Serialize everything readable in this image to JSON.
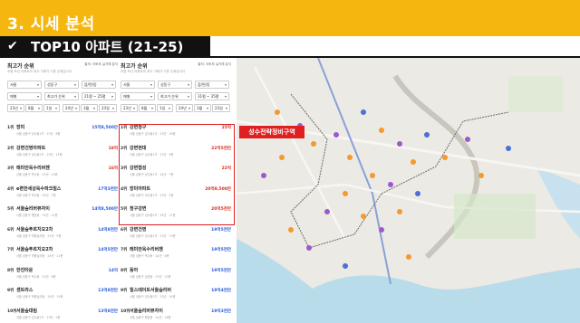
{
  "header": {
    "section_title": "3. 시세 분석",
    "subtitle": "TOP10 아파트 (21-25)",
    "check_icon": "check-icon"
  },
  "colors": {
    "accent": "#f5b70f",
    "highlight": "#e02020",
    "price_blue": "#2a5bd7"
  },
  "left_panel": {
    "title": "최고가 순위",
    "note": "출처: 국토부 실거래 분석",
    "desc": "지정 조건 아파트의 최고 거래가 기준 순위입니다",
    "filters": {
      "region": "서울",
      "district": "성동구",
      "dong": "읍/면/동",
      "type": "매매",
      "sort": "최고가 순위",
      "size": "21평 ~ 25평",
      "from_year": "23년",
      "from_month": "8월",
      "from_day": "1일",
      "to_year": "24년",
      "to_month": "3월",
      "to_day": "23일"
    },
    "ranks": [
      {
        "rank": "1위",
        "name": "장미",
        "sub": "서울 성동구 성수동1가 · 23년 · 8층",
        "price": "15억8,500만"
      },
      {
        "rank": "2위",
        "name": "강변건영아파트",
        "sub": "서울 성동구 성수동2가 · 23년 · 14층",
        "price": "18억"
      },
      {
        "rank": "3위",
        "name": "래미안옥수리버젠",
        "sub": "서울 성동구 옥수동 · 23년 · 10층",
        "price": "16억"
      },
      {
        "rank": "4위",
        "name": "e편한세상옥수파크힐스",
        "sub": "서울 성동구 옥수동 · 24년 · 7층",
        "price": "17억3천만"
      },
      {
        "rank": "5위",
        "name": "서울숲리버뷰자이",
        "sub": "서울 성동구 행당동 · 23년 · 12층",
        "price": "14억8,500만"
      },
      {
        "rank": "6위",
        "name": "서울숲푸르지오2차",
        "sub": "서울 성동구 하왕십리동 · 23년 · 9층",
        "price": "14억8천만"
      },
      {
        "rank": "7위",
        "name": "서울숲푸르지오2차",
        "sub": "서울 성동구 하왕십리동 · 24년 · 11층",
        "price": "14억5천만"
      },
      {
        "rank": "8위",
        "name": "한진타운",
        "sub": "서울 성동구 옥수동 · 23년 · 6층",
        "price": "14억"
      },
      {
        "rank": "9위",
        "name": "센트라스",
        "sub": "서울 성동구 하왕십리동 · 24년 · 15층",
        "price": "13억8천만"
      },
      {
        "rank": "10위",
        "name": "서울숲대림",
        "sub": "서울 성동구 성수동2가 · 23년 · 5층",
        "price": "13억8천만"
      }
    ]
  },
  "mid_panel": {
    "title": "최고가 순위",
    "note": "출처: 국토부 실거래 분석",
    "desc": "지정 조건 아파트의 최고 거래가 기준 순위입니다",
    "filters": {
      "region": "서울",
      "district": "성동구",
      "dong": "읍/면/동",
      "type": "매매",
      "sort": "최고가 순위",
      "size": "31평 ~ 35평",
      "from_year": "23년",
      "from_month": "8월",
      "from_day": "1일",
      "to_year": "24년",
      "to_month": "3월",
      "to_day": "23일"
    },
    "ranks": [
      {
        "rank": "1위",
        "name": "강변청구",
        "sub": "서울 성동구 성수동1가 · 23년 · 16층",
        "price": "25억"
      },
      {
        "rank": "2위",
        "name": "강변현대",
        "sub": "서울 성동구 성수동1가 · 23년 · 9층",
        "price": "22억5천만"
      },
      {
        "rank": "3위",
        "name": "강변협성",
        "sub": "서울 성동구 성수동1가 · 24년 · 7층",
        "price": "22억"
      },
      {
        "rank": "4위",
        "name": "장미아파트",
        "sub": "서울 성동구 성수동1가 · 23년 · 4층",
        "price": "20억9,500만"
      },
      {
        "rank": "5위",
        "name": "청구강변",
        "sub": "서울 성동구 성수동1가 · 24년 · 11층",
        "price": "20억5천만"
      },
      {
        "rank": "6위",
        "name": "강변건영",
        "sub": "서울 성동구 성수동2가 · 23년 · 13층",
        "price": "19억5천만"
      },
      {
        "rank": "7위",
        "name": "래미안옥수리버젠",
        "sub": "서울 성동구 옥수동 · 24년 · 8층",
        "price": "19억5천만"
      },
      {
        "rank": "8위",
        "name": "동아",
        "sub": "서울 성동구 금호동 · 23년 · 10층",
        "price": "19억5천만"
      },
      {
        "rank": "9위",
        "name": "힐스테이트서울숲리버",
        "sub": "서울 성동구 성수동2가 · 23년 · 14층",
        "price": "19억4천만"
      },
      {
        "rank": "10위",
        "name": "서울숲리버뷰자이",
        "sub": "서울 성동구 행당동 · 24년 · 18층",
        "price": "19억3천만"
      }
    ]
  },
  "map": {
    "redev_label": "성수전략정비구역"
  }
}
